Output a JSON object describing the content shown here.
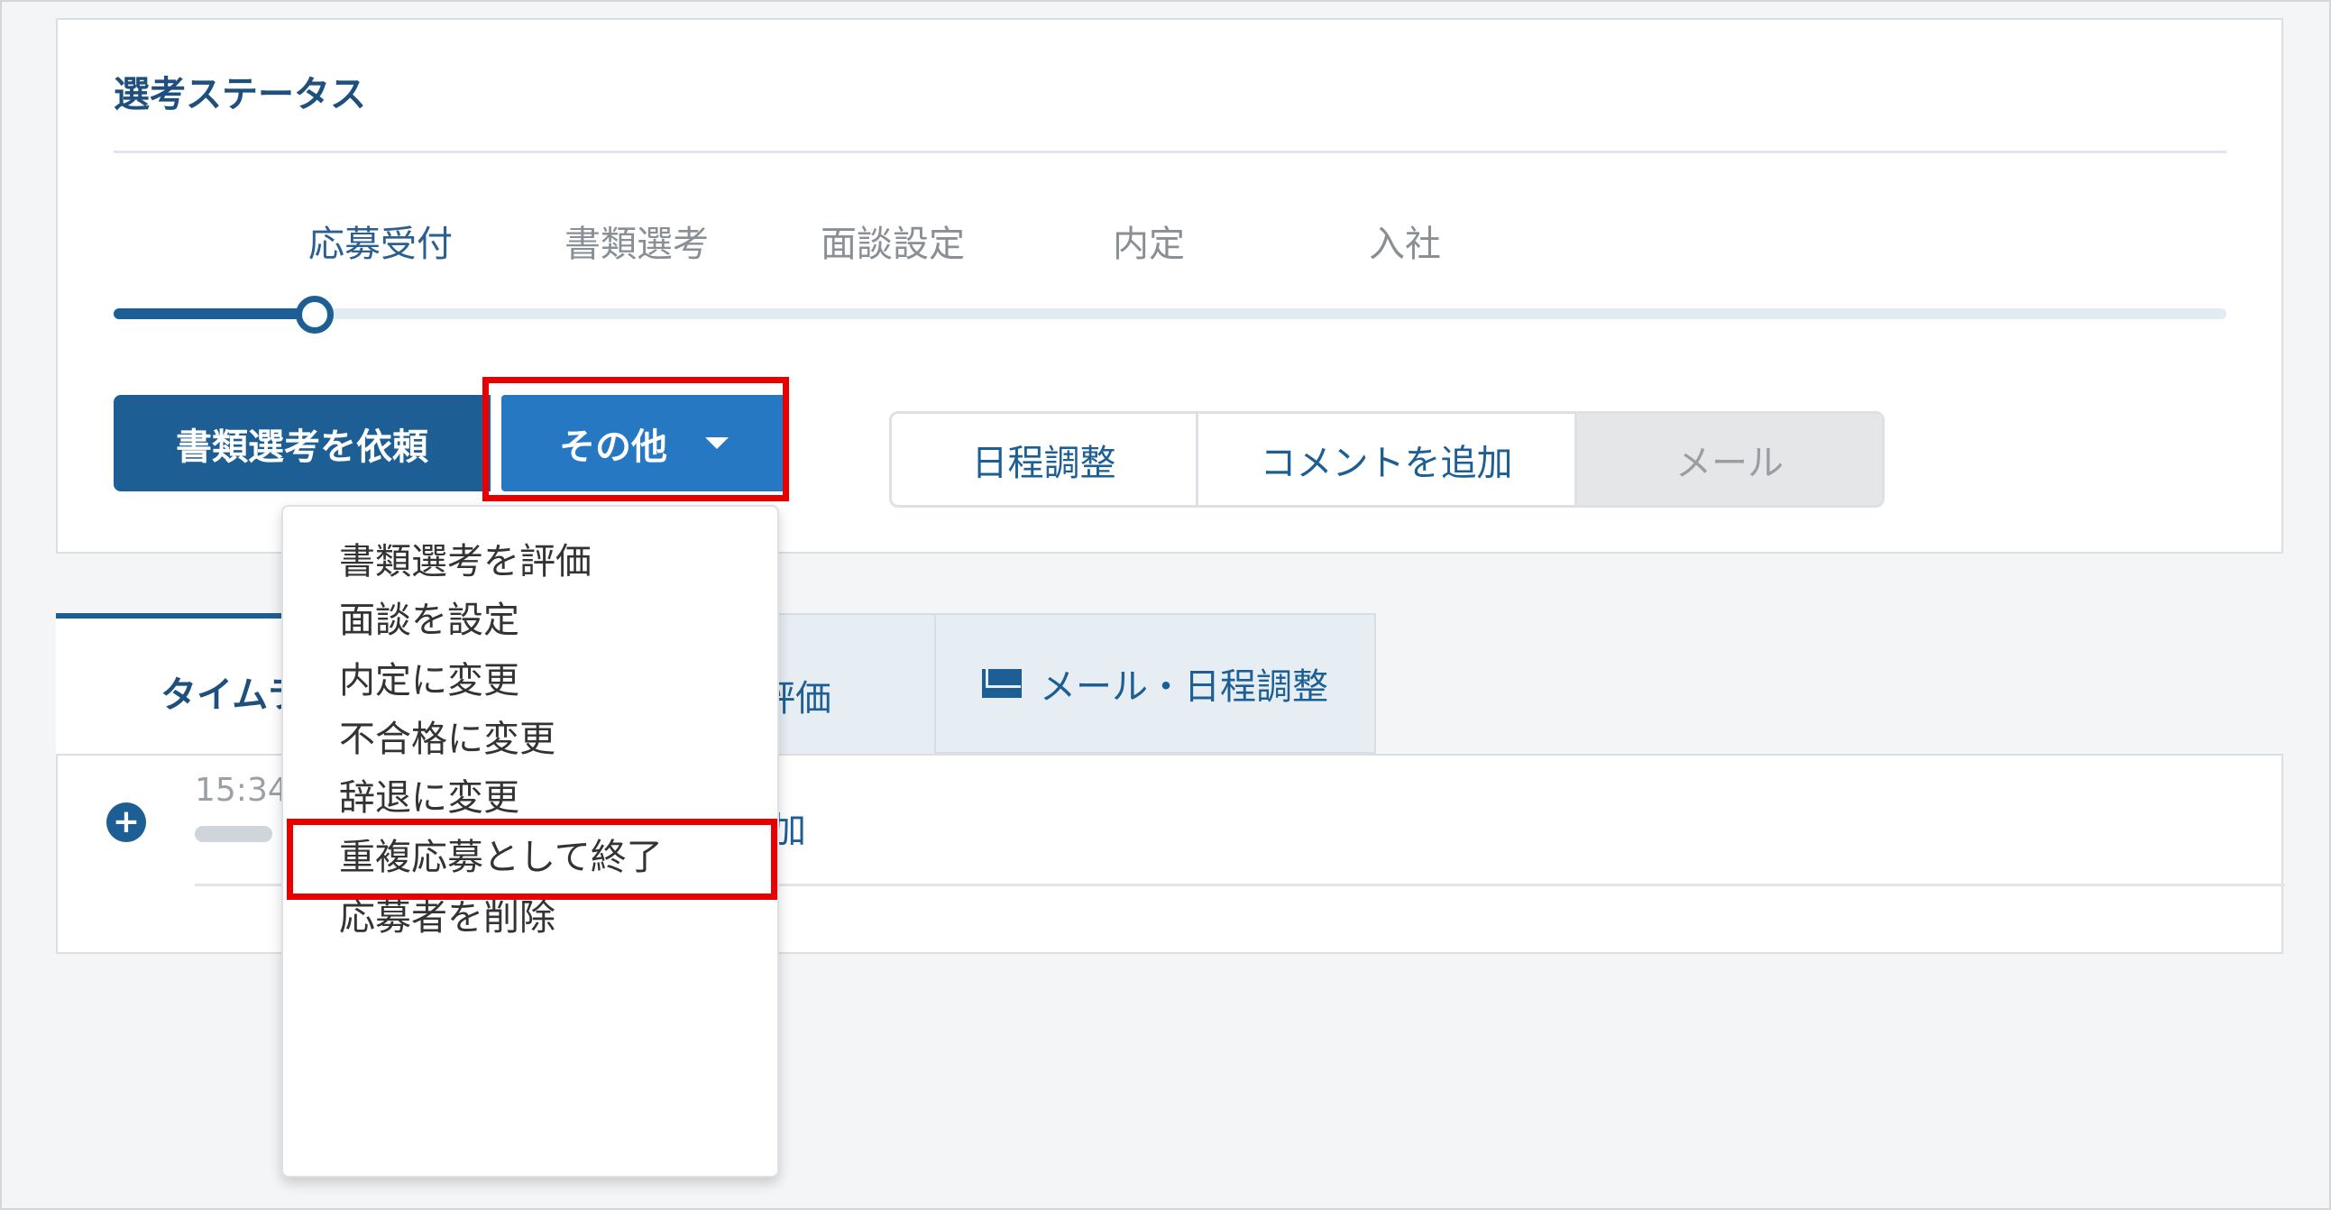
{
  "status_section": {
    "title": "選考ステータス",
    "steps": [
      "応募受付",
      "書類選考",
      "面談設定",
      "内定",
      "入社"
    ],
    "current_step": "応募受付",
    "progress_fraction": 0.095
  },
  "actions": {
    "primary_label": "書類選考を依頼",
    "other_label": "その他",
    "segment": [
      "日程調整",
      "コメントを追加",
      "メール"
    ]
  },
  "dropdown": {
    "items": [
      "書類選考を評価",
      "面談を設定",
      "内定に変更",
      "不合格に変更",
      "辞退に変更",
      "重複応募として終了",
      "応募者を削除"
    ],
    "highlighted": "重複応募として終了"
  },
  "tabs": {
    "timeline_label": "タイムラ",
    "evaluation_label": "評価",
    "mail_label": "メール・日程調整"
  },
  "timeline": {
    "time": "15:34",
    "text": "加"
  },
  "colors": {
    "primary": "#1d5f94",
    "accent": "#2678c2",
    "highlight": "#e60000"
  }
}
